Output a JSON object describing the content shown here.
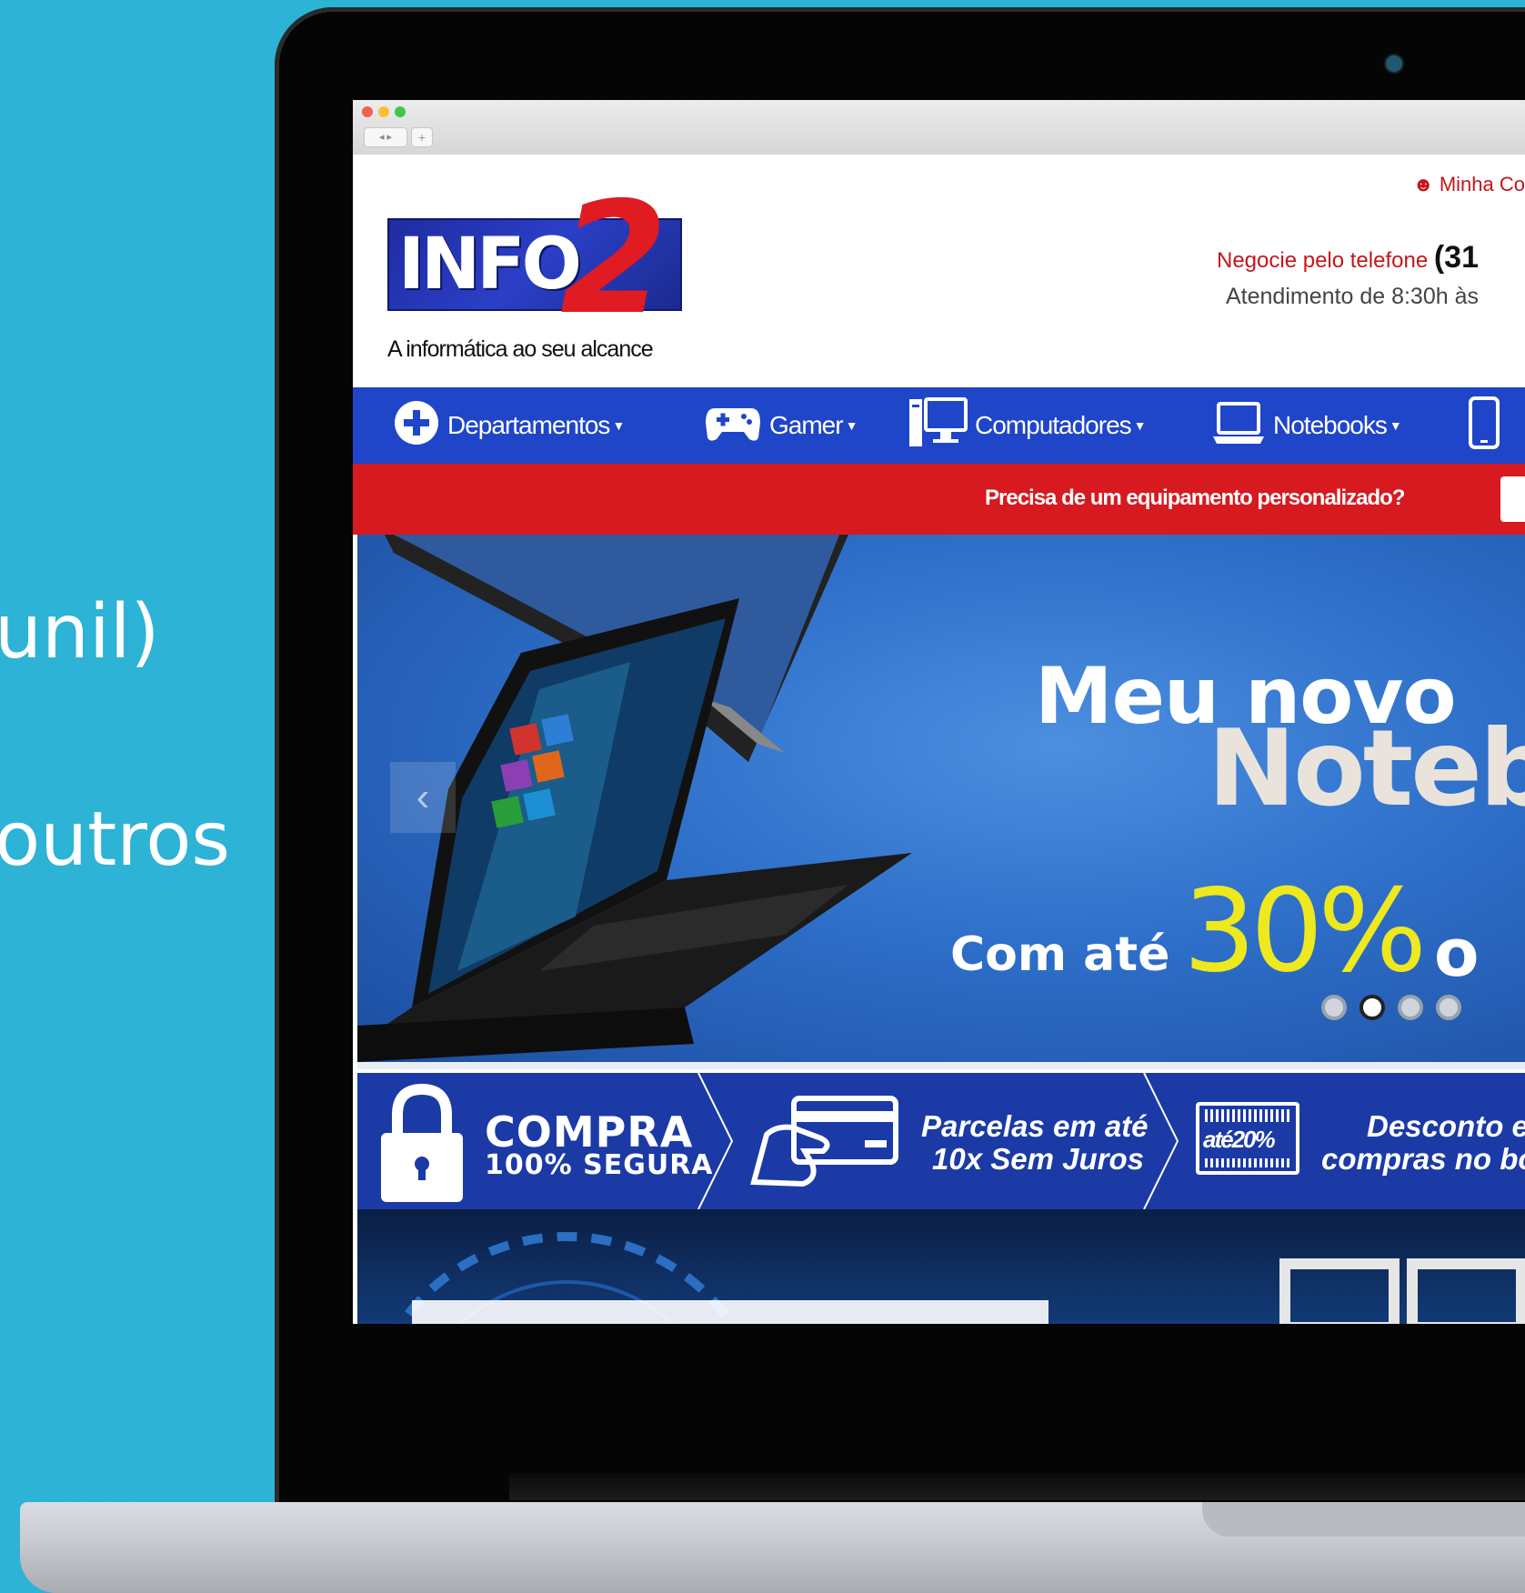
{
  "side_text": {
    "line1": "unil)",
    "line2": "outros"
  },
  "browser": {
    "back_label": "◂ ▸",
    "newtab_label": "+"
  },
  "site": {
    "logo_text": "INFO",
    "logo_number": "2",
    "tagline": "A informática ao seu alcance",
    "account_label": "Minha Co",
    "phone_prefix": "Negocie pelo telefone",
    "phone_number": "(31",
    "hours": "Atendimento de 8:30h às"
  },
  "nav": {
    "items": [
      {
        "label": "Departamentos",
        "icon": "plus-circle-icon"
      },
      {
        "label": "Gamer",
        "icon": "gamepad-icon"
      },
      {
        "label": "Computadores",
        "icon": "desktop-computer-icon"
      },
      {
        "label": "Notebooks",
        "icon": "laptop-icon"
      }
    ]
  },
  "promo_bar": {
    "text": "Precisa de um equipamento personalizado?"
  },
  "banner": {
    "line1": "Meu novo",
    "line2": "Noteb",
    "line3_prefix": "Com até",
    "line3_pct": "30%",
    "line3_suffix": "o",
    "slides": 4,
    "active_slide": 2
  },
  "features": {
    "f1_title": "COMPRA",
    "f1_sub": "100% SEGURA",
    "f2_line1": "Parcelas em até",
    "f2_line2": "10x Sem Juros",
    "f3_badge": "até20%",
    "f3_line1": "Desconto e",
    "f3_line2": "compras no bo"
  },
  "colors": {
    "background": "#2db3d5",
    "nav_blue": "#1f45c9",
    "promo_red": "#d71920",
    "accent_yellow": "#eee81f"
  }
}
